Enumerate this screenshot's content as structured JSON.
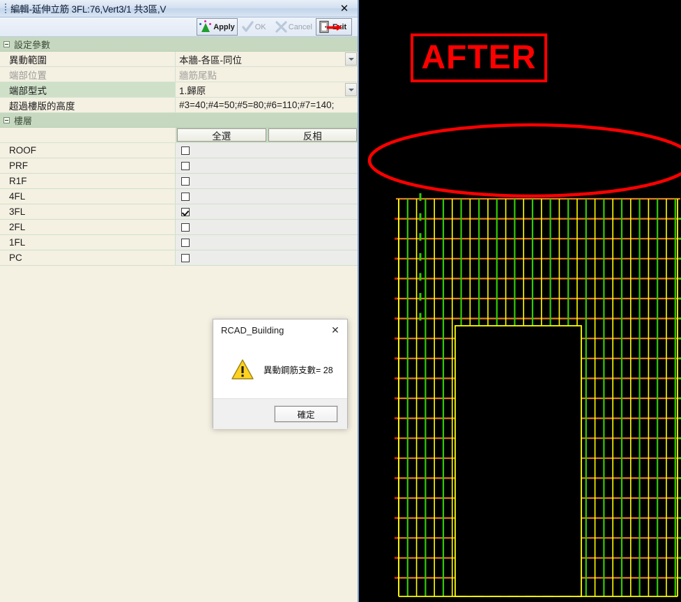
{
  "window": {
    "title": "編輯-延伸立筋 3FL:76,Vert3/1 共3區,V",
    "close_label": "✕"
  },
  "toolbar": {
    "apply_label": "Apply",
    "ok_label": "OK",
    "cancel_label": "Cancel",
    "exit_label": "Exit"
  },
  "params": {
    "section_title": "設定參數",
    "rows": [
      {
        "name": "異動範圍",
        "value": "本牆-各區-同位",
        "dropdown": true,
        "disabled": false,
        "selected": false
      },
      {
        "name": "端部位置",
        "value": "牆筋尾點",
        "dropdown": false,
        "disabled": true,
        "selected": false
      },
      {
        "name": "端部型式",
        "value": "1.歸原",
        "dropdown": true,
        "disabled": false,
        "selected": true
      },
      {
        "name": "超過樓版的高度",
        "value": "#3=40;#4=50;#5=80;#6=110;#7=140;",
        "dropdown": false,
        "disabled": false,
        "selected": false
      }
    ]
  },
  "floors": {
    "section_title": "樓層",
    "select_all_label": "全選",
    "invert_label": "反相",
    "items": [
      {
        "label": "ROOF",
        "checked": false
      },
      {
        "label": "PRF",
        "checked": false
      },
      {
        "label": "R1F",
        "checked": false
      },
      {
        "label": "4FL",
        "checked": false
      },
      {
        "label": "3FL",
        "checked": true
      },
      {
        "label": "2FL",
        "checked": false
      },
      {
        "label": "1FL",
        "checked": false
      },
      {
        "label": "PC",
        "checked": false
      }
    ]
  },
  "messagebox": {
    "title": "RCAD_Building",
    "close_label": "✕",
    "message": "異動鋼筋支數= 28",
    "ok_label": "確定",
    "icon": "warning-triangle-icon"
  },
  "cad": {
    "annotation_label": "AFTER",
    "annotation_color": "#ff0000",
    "background": "#000000",
    "colors": {
      "vertical_rebar": "#ffff00",
      "stirrup_green": "#33cc00",
      "horizontal_rebar": "#e08020",
      "marker_red": "#cc2200",
      "highlight": "#ff0000"
    }
  }
}
